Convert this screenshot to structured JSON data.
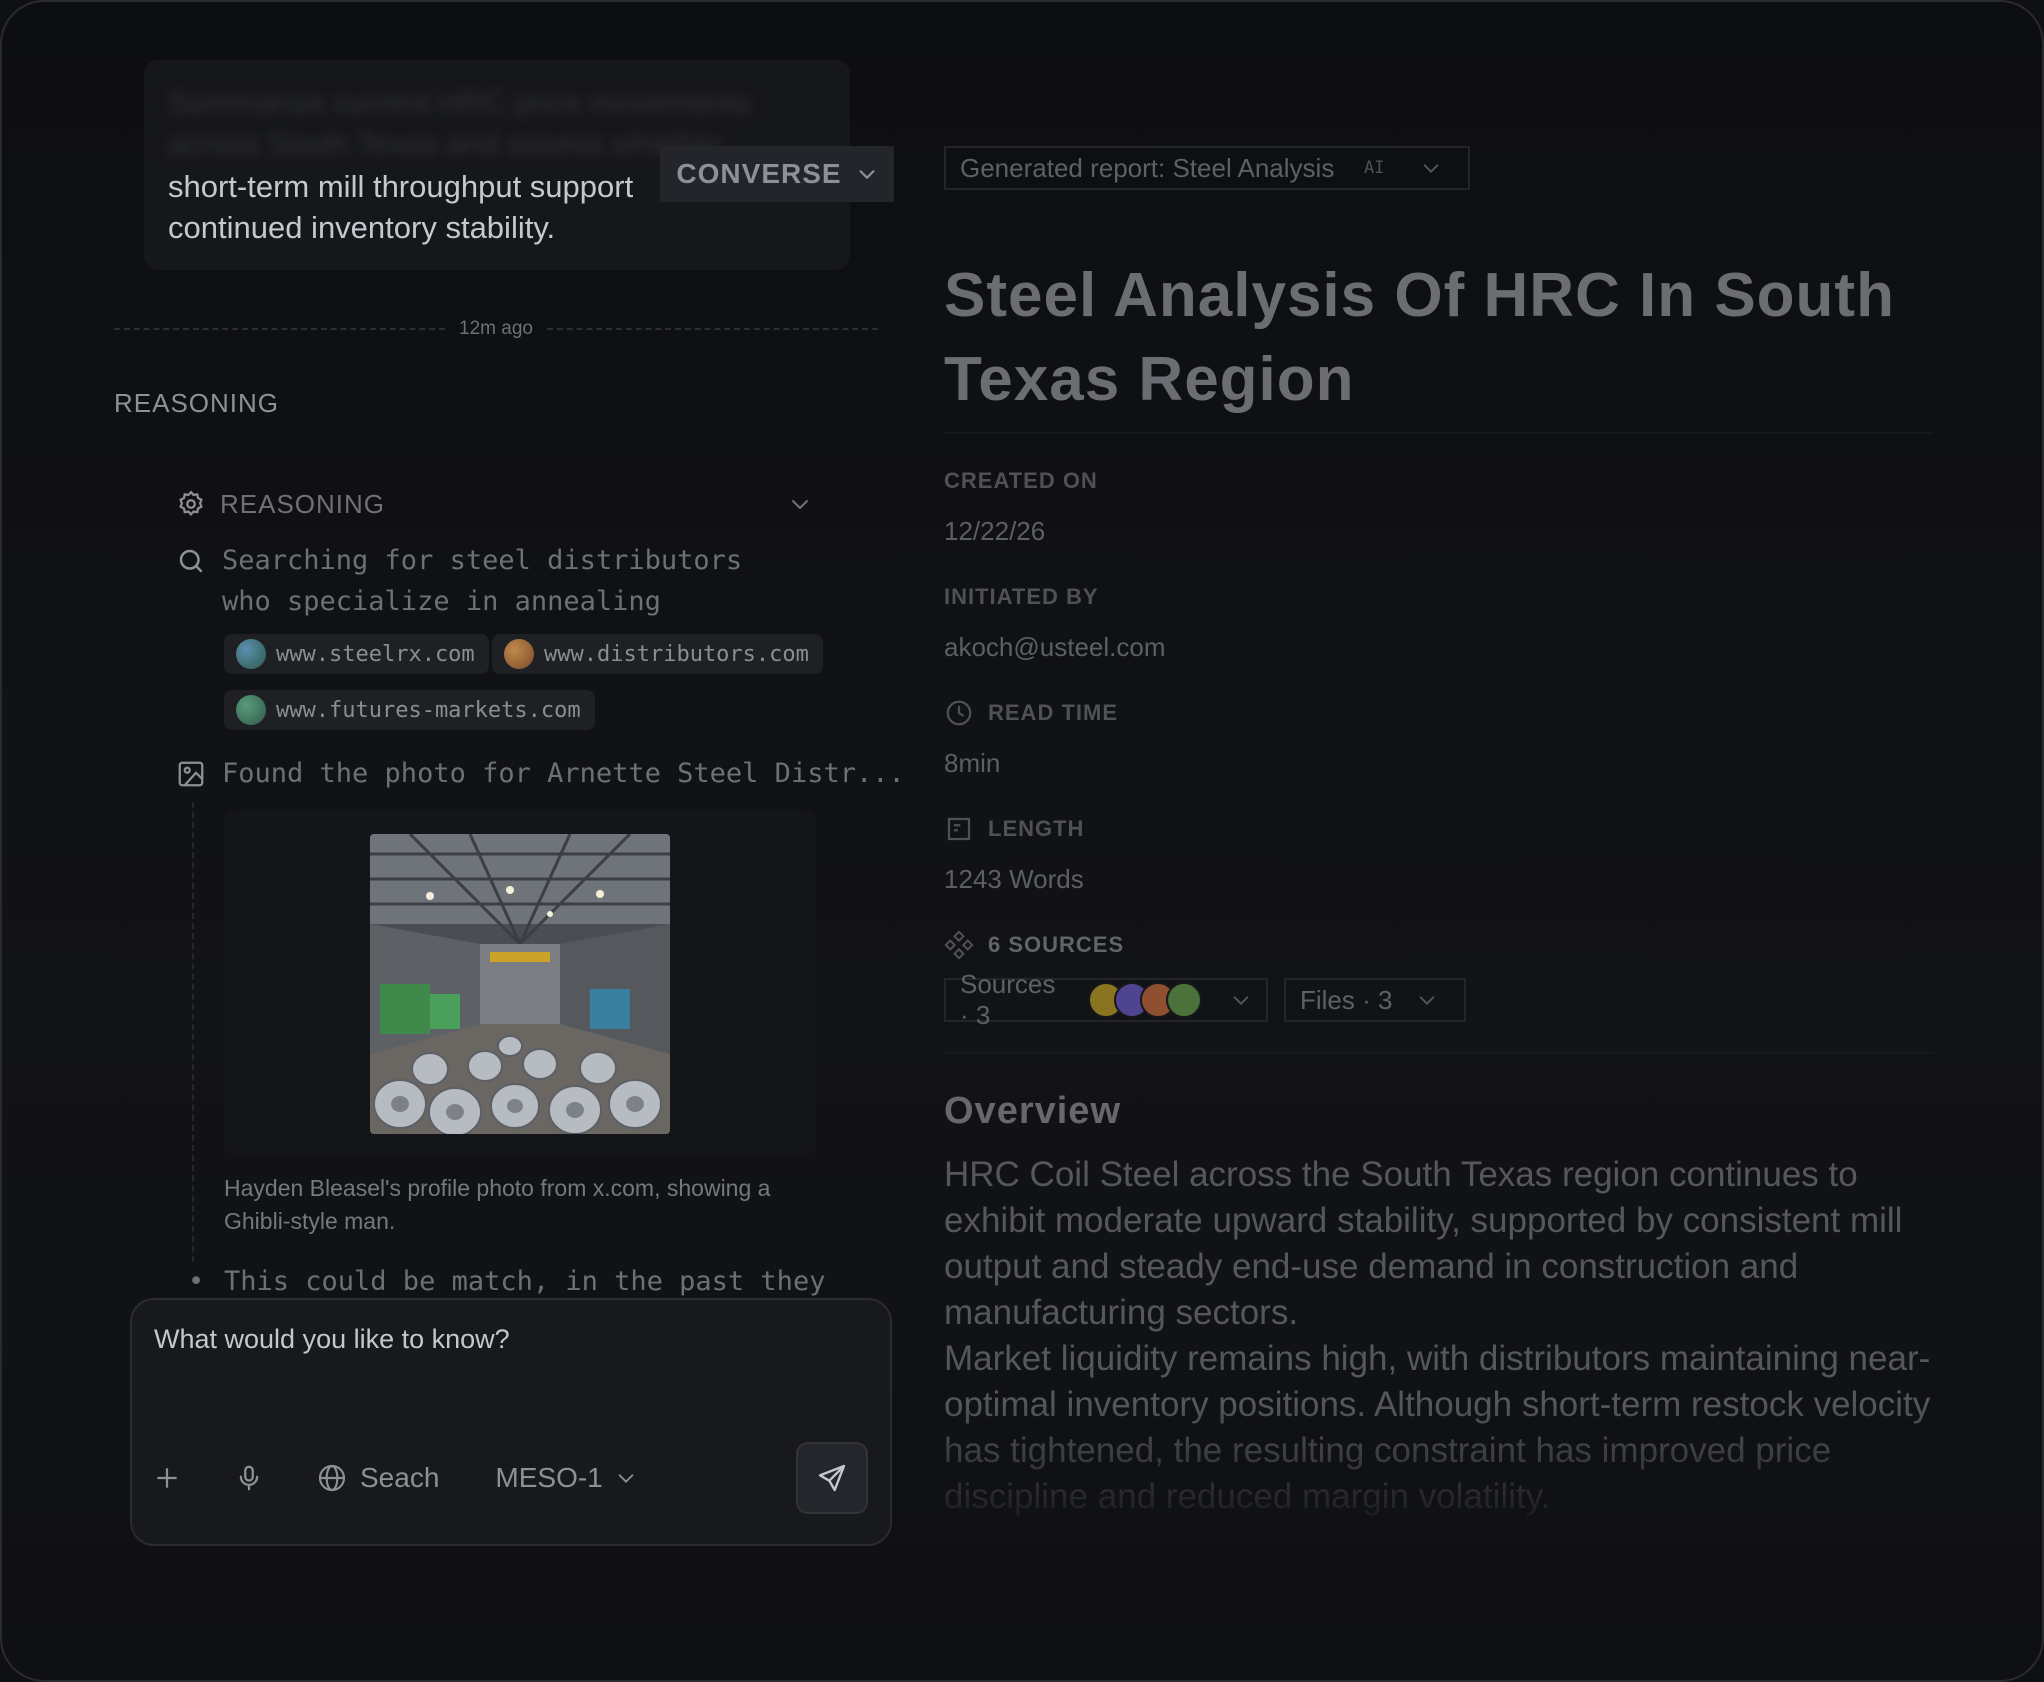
{
  "left": {
    "prompt": {
      "hidden_text": "Summarize current HRC price movements across South Texas and assess whether",
      "visible_text": "short-term mill throughput support\ncontinued inventory stability."
    },
    "converse_label": "CONVERSE",
    "timestamp": "12m ago",
    "section_title": "REASONING",
    "reasoning": {
      "header": "REASONING",
      "search_text": "Searching for steel distributors who specialize in annealing",
      "sources": [
        {
          "label": "www.steelrx.com",
          "color": "#3d6b8a"
        },
        {
          "label": "www.distributors.com",
          "color": "#a0703c"
        },
        {
          "label": "www.futures-markets.com",
          "color": "#3f7a62"
        }
      ],
      "photo_step": "Found the photo for Arnette Steel Distr...",
      "photo_caption": "Hayden Bleasel's profile photo from x.com, showing a Ghibli-style man.",
      "bullet_text": "This could be match, in the past they have"
    },
    "composer": {
      "placeholder": "What would you like to know?",
      "search_label": "Seach",
      "model_label": "MESO-1"
    }
  },
  "right": {
    "report_select": "Generated report: Steel Analysis",
    "ai_tag": "AI",
    "title": "Steel Analysis Of HRC In South Texas Region",
    "created_label": "CREATED ON",
    "created_value": "12/22/26",
    "initiated_label": "INITIATED BY",
    "initiated_value": "akoch@usteel.com",
    "read_time_label": "READ TIME",
    "read_time_value": "8min",
    "length_label": "LENGTH",
    "length_value": "1243  Words",
    "sources_label": "6 SOURCES",
    "sources_select": "Sources · 3",
    "files_select": "Files · 3",
    "avatar_colors": [
      "#c9a227",
      "#6b5bd2",
      "#d46a3a",
      "#5f9e4a"
    ],
    "overview_title": "Overview",
    "overview_p1": "HRC Coil Steel across the South Texas region continues to exhibit moderate upward stability, supported by consistent mill output and steady end-use demand in construction and manufacturing sectors.",
    "overview_p2": "Market liquidity remains high, with distributors maintaining near-optimal inventory positions. Although short-term restock velocity has tightened, the resulting constraint has improved price discipline and reduced margin volatility."
  }
}
